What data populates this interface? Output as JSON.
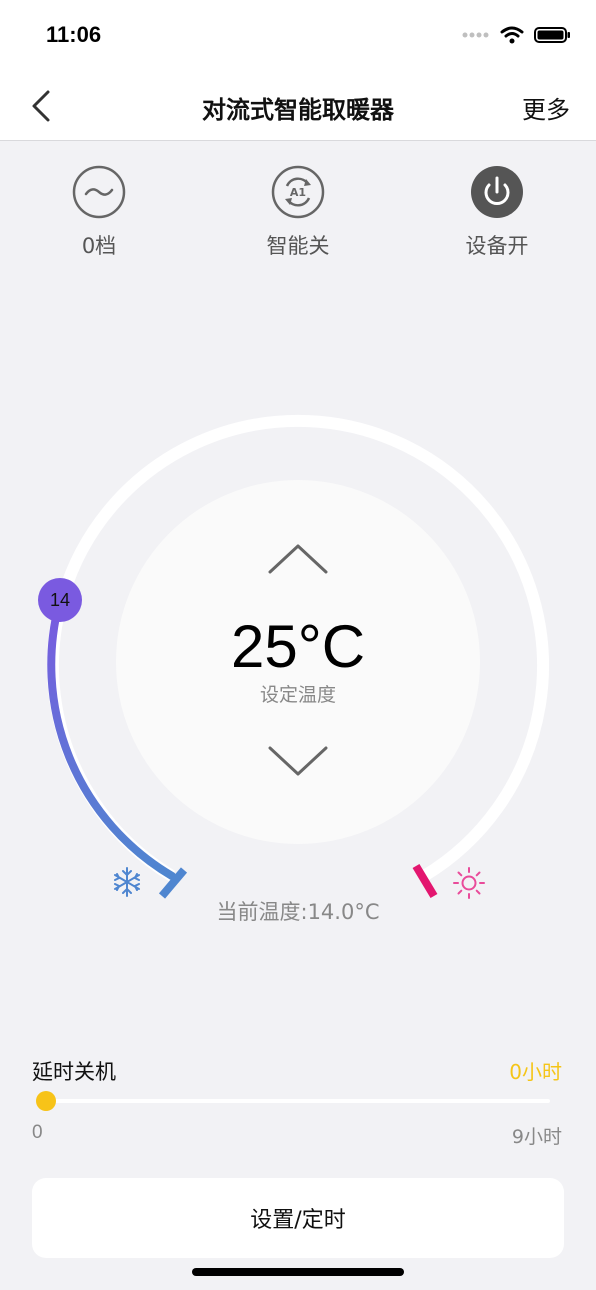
{
  "status": {
    "time": "11:06",
    "icons": [
      "signal-dots-icon",
      "wifi-icon",
      "battery-icon"
    ]
  },
  "header": {
    "title": "对流式智能取暖器",
    "more_label": "更多",
    "back_icon": "chevron-left-icon"
  },
  "quick_actions": [
    {
      "label": "0档",
      "icon": "fan-speed-icon"
    },
    {
      "label": "智能关",
      "icon": "ai-mode-icon"
    },
    {
      "label": "设备开",
      "icon": "power-icon"
    }
  ],
  "thermostat": {
    "set_temp": "25°C",
    "set_label": "设定温度",
    "current_temp": "当前温度:14.0°C",
    "knob_value": "14",
    "cold_icon": "snowflake-icon",
    "hot_icon": "sun-icon",
    "colors": {
      "ring": "#ffffff",
      "arc_start": "#7a5ae0",
      "arc_end": "#4f86d0",
      "hot_marker": "#e3166f",
      "hot_icon": "#e94b9a",
      "cold_icon": "#4f86d0"
    }
  },
  "delay_shutdown": {
    "title": "延时关机",
    "value": "0小时",
    "min_label": "0",
    "max_label": "9小时",
    "accent": "#f5c518",
    "level": 0
  },
  "bottom_button": {
    "label": "设置/定时"
  }
}
